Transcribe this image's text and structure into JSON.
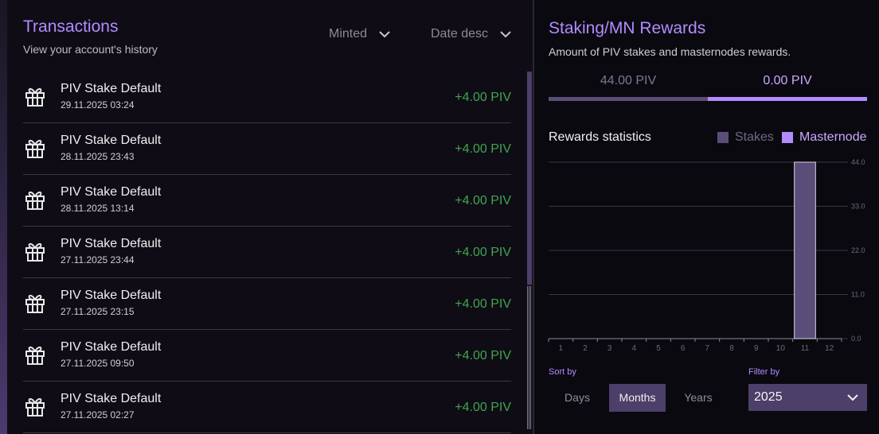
{
  "transactions": {
    "title": "Transactions",
    "subtitle": "View your account's history",
    "filter_type": "Minted",
    "filter_sort": "Date desc",
    "items": [
      {
        "name": "PIV Stake Default",
        "date": "29.11.2025 03:24",
        "amount": "+4.00 PIV"
      },
      {
        "name": "PIV Stake Default",
        "date": "28.11.2025 23:43",
        "amount": "+4.00 PIV"
      },
      {
        "name": "PIV Stake Default",
        "date": "28.11.2025 13:14",
        "amount": "+4.00 PIV"
      },
      {
        "name": "PIV Stake Default",
        "date": "27.11.2025 23:44",
        "amount": "+4.00 PIV"
      },
      {
        "name": "PIV Stake Default",
        "date": "27.11.2025 23:15",
        "amount": "+4.00 PIV"
      },
      {
        "name": "PIV Stake Default",
        "date": "27.11.2025 09:50",
        "amount": "+4.00 PIV"
      },
      {
        "name": "PIV Stake Default",
        "date": "27.11.2025 02:27",
        "amount": "+4.00 PIV"
      }
    ]
  },
  "rewards": {
    "title": "Staking/MN Rewards",
    "subtitle": "Amount of PIV stakes and masternodes rewards.",
    "stakes_total": "44.00 PIV",
    "masternode_total": "0.00 PIV",
    "stats_title": "Rewards statistics",
    "legend_stakes": "Stakes",
    "legend_masternode": "Masternode",
    "sort_label": "Sort by",
    "sort_options": [
      "Days",
      "Months",
      "Years"
    ],
    "sort_selected": "Months",
    "filter_label": "Filter by",
    "year_selected": "2025"
  },
  "colors": {
    "accent": "#b18cff",
    "stakes": "#5a4e78",
    "positive": "#3fa64c"
  },
  "chart_data": {
    "type": "bar",
    "categories": [
      "1",
      "2",
      "3",
      "4",
      "5",
      "6",
      "7",
      "8",
      "9",
      "10",
      "11",
      "12"
    ],
    "series": [
      {
        "name": "Stakes",
        "values": [
          0,
          0,
          0,
          0,
          0,
          0,
          0,
          0,
          0,
          0,
          44,
          0
        ]
      },
      {
        "name": "Masternode",
        "values": [
          0,
          0,
          0,
          0,
          0,
          0,
          0,
          0,
          0,
          0,
          0,
          0
        ]
      }
    ],
    "yticks": [
      "0.0",
      "11.0",
      "22.0",
      "33.0",
      "44.0"
    ],
    "ylim": [
      0,
      44
    ],
    "grid": true
  }
}
